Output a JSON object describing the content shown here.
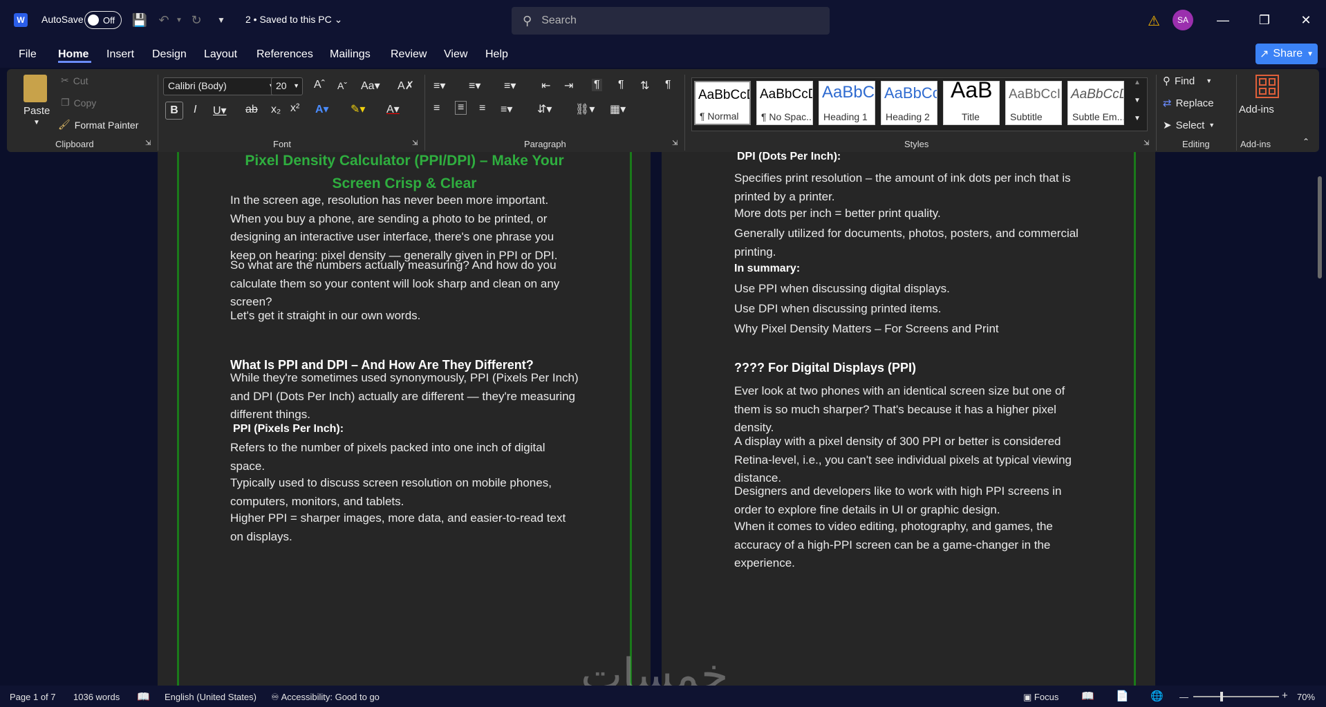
{
  "titlebar": {
    "autosave_label": "AutoSave",
    "autosave_state": "Off",
    "doc_title": "2 • Saved to this PC",
    "search_placeholder": "Search",
    "avatar_initials": "SA"
  },
  "menu": {
    "items": [
      "File",
      "Home",
      "Insert",
      "Design",
      "Layout",
      "References",
      "Mailings",
      "Review",
      "View",
      "Help"
    ],
    "active": "Home",
    "share_label": "Share"
  },
  "ribbon": {
    "clipboard": {
      "paste": "Paste",
      "cut": "Cut",
      "copy": "Copy",
      "format_painter": "Format Painter",
      "label": "Clipboard"
    },
    "font": {
      "family": "Calibri (Body)",
      "size": "20",
      "label": "Font"
    },
    "paragraph": {
      "label": "Paragraph"
    },
    "styles": {
      "label": "Styles",
      "tiles": [
        {
          "sample": "AaBbCcD",
          "name": "¶ Normal"
        },
        {
          "sample": "AaBbCcD",
          "name": "¶ No Spac..."
        },
        {
          "sample": "AaBbC",
          "name": "Heading 1"
        },
        {
          "sample": "AaBbCc",
          "name": "Heading 2"
        },
        {
          "sample": "AaB",
          "name": "Title"
        },
        {
          "sample": "AaBbCcI",
          "name": "Subtitle"
        },
        {
          "sample": "AaBbCcDi",
          "name": "Subtle Em..."
        }
      ]
    },
    "editing": {
      "find": "Find",
      "replace": "Replace",
      "select": "Select",
      "label": "Editing"
    },
    "addins": {
      "button": "Add-ins",
      "label": "Add-ins"
    }
  },
  "doc": {
    "left": {
      "title_line1": "Pixel Density Calculator (PPI/DPI) – Make Your",
      "title_line2": "Screen Crisp & Clear",
      "p1": [
        "In the screen age, resolution has never been more important.",
        "When you buy a phone, are sending a photo to be printed, or",
        "designing an interactive user interface, there's one phrase you",
        "keep on hearing: pixel density — generally given in PPI or DPI."
      ],
      "p2": [
        "So what are the numbers actually measuring? And how do you",
        "calculate them so your content will look sharp and clean on any",
        "screen?"
      ],
      "p3": "Let's get it straight in our own words.",
      "h1": "What Is PPI and DPI – And How Are They Different?",
      "p4": [
        "While they're sometimes used synonymously, PPI (Pixels Per Inch)",
        "and DPI (Dots Per Inch) actually are different — they're measuring",
        "different things."
      ],
      "b1": "PPI (Pixels Per Inch):",
      "p5": [
        "Refers to the number of pixels packed into one inch of digital",
        "space."
      ],
      "p6": [
        "Typically used to discuss screen resolution on mobile phones,",
        "computers, monitors, and tablets."
      ],
      "p7": [
        "Higher PPI = sharper images, more data, and easier-to-read text",
        "on displays."
      ]
    },
    "right": {
      "b1": "DPI (Dots Per Inch):",
      "p1": [
        "Specifies print resolution – the amount of ink dots per inch that is",
        "printed by a printer."
      ],
      "p2": "More dots per inch = better print quality.",
      "p3": [
        "Generally utilized for documents, photos, posters, and commercial",
        "printing."
      ],
      "b2": "In summary:",
      "p4": "Use PPI when discussing digital displays.",
      "p5": "Use DPI when discussing printed items.",
      "p6": "Why Pixel Density Matters – For Screens and Print",
      "h1": "???? For Digital Displays (PPI)",
      "p7": [
        "Ever look at two phones with an identical screen size but one of",
        "them is so much sharper? That's because it has a higher pixel",
        "density."
      ],
      "p8": [
        "A display with a pixel density of 300 PPI or better is considered",
        "Retina-level, i.e., you can't see individual pixels at typical viewing",
        "distance."
      ],
      "p9": [
        "Designers and developers like to work with high PPI screens in",
        "order to explore fine details in UI or graphic design."
      ],
      "p10": [
        "When it comes to video editing, photography, and games, the",
        "accuracy of a high-PPI screen can be a game-changer in the",
        "experience."
      ]
    }
  },
  "status": {
    "page": "Page 1 of 7",
    "words": "1036 words",
    "language": "English (United States)",
    "accessibility": "Accessibility: Good to go",
    "focus": "Focus",
    "zoom": "70%",
    "zoom_value": 0.7
  },
  "watermark": "خمسات",
  "colors": {
    "accent": "#6b8cff",
    "title_green": "#2fae3f",
    "page_border_green": "#1a7a1a",
    "share": "#3b82f6",
    "avatar": "#9b2fae"
  }
}
